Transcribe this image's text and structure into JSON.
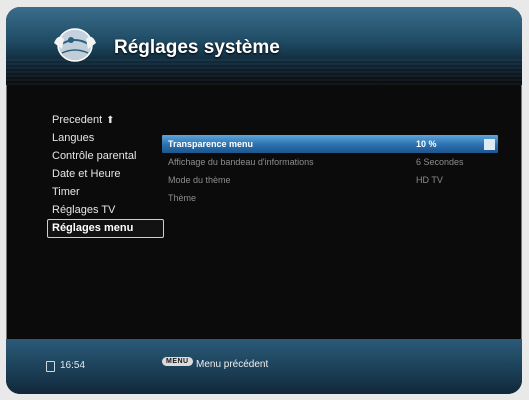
{
  "header": {
    "title": "Réglages système",
    "logo_icon": "globe-hands-logo"
  },
  "sidebar": {
    "items": [
      {
        "label": "Precedent",
        "icon": "arrow-up-icon"
      },
      {
        "label": "Langues"
      },
      {
        "label": "Contrôle parental"
      },
      {
        "label": "Date et Heure"
      },
      {
        "label": "Timer"
      },
      {
        "label": "Réglages TV"
      },
      {
        "label": "Réglages menu",
        "active": true
      }
    ]
  },
  "settings": {
    "rows": [
      {
        "label": "Transparence menu",
        "value": "10 %",
        "selected": true
      },
      {
        "label": "Affichage du bandeau d'informations",
        "value": "6 Secondes"
      },
      {
        "label": "Mode du thème",
        "value": "HD TV"
      },
      {
        "label": "Thème",
        "value": ""
      }
    ]
  },
  "footer": {
    "time": "16:54",
    "menu_key": "MENU",
    "hint": "Menu précédent"
  },
  "colors": {
    "selection": "#2a70b0",
    "header": "#1f4a63",
    "background": "#0b0b0c"
  }
}
